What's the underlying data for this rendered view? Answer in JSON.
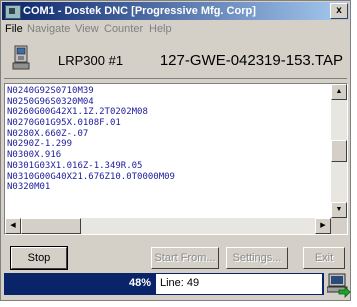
{
  "window": {
    "title": "COM1 - Dostek DNC [Progressive Mfg. Corp]",
    "close_label": "x"
  },
  "menu": [
    {
      "label": "File",
      "enabled": true
    },
    {
      "label": "Navigate",
      "enabled": false
    },
    {
      "label": "View",
      "enabled": false
    },
    {
      "label": "Counter",
      "enabled": false
    },
    {
      "label": "Help",
      "enabled": false
    }
  ],
  "toolbar": {
    "machine_icon": "machine-icon",
    "machine_name": "LRP300 #1",
    "file_name": "127-GWE-042319-153.TAP"
  },
  "code_lines": [
    "N0240G92S0710M39",
    "N0250G96S0320M04",
    "N0260G00G42X1.1Z.2T0202M08",
    "N0270G01G95X.0108F.01",
    "N0280X.660Z-.07",
    "N0290Z-1.299",
    "N0300X.916",
    "N0301G03X1.016Z-1.349R.05",
    "N0310G00G40X21.676Z10.0T0000M09",
    "N0320M01"
  ],
  "buttons": {
    "stop": "Stop",
    "start_from": "Start From...",
    "settings": "Settings...",
    "exit": "Exit"
  },
  "status": {
    "progress_percent": 48,
    "percent_label": "48%",
    "line_label": "Line: 49",
    "send_icon": "send-data-icon"
  },
  "colors": {
    "title_start": "#0a246a",
    "title_end": "#a6caf0",
    "code_text": "#1c1c9c",
    "progress": "#0a246a"
  }
}
